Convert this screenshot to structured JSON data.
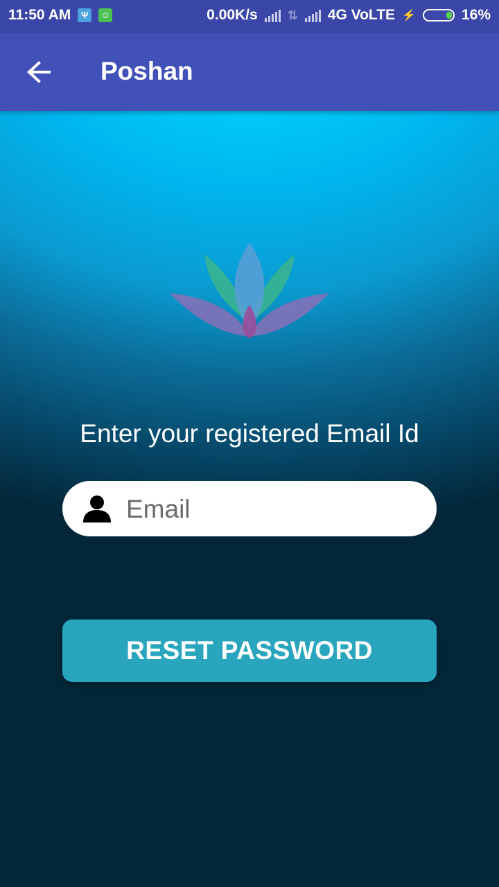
{
  "status_bar": {
    "time": "11:50 AM",
    "net_speed": "0.00K/s",
    "network_type": "4G VoLTE",
    "battery_percent": "16%",
    "icons": [
      "usb-icon",
      "android-bot-icon",
      "signal-icon",
      "data-arrows-icon",
      "signal-icon",
      "charging-icon",
      "battery-icon"
    ]
  },
  "app_bar": {
    "title": "Poshan",
    "back_icon": "arrow-left-icon"
  },
  "logo": {
    "name": "lotus-logo",
    "colors": [
      "#3bb58c",
      "#5a9fd6",
      "#8a6fb8",
      "#9c4e9a"
    ]
  },
  "form": {
    "prompt": "Enter your registered Email Id",
    "email_placeholder": "Email",
    "email_value": "",
    "email_icon": "person-icon",
    "reset_button": "RESET PASSWORD"
  },
  "colors": {
    "status_bar": "#3b47a8",
    "app_bar": "#4151b8",
    "button": "#29a6bd",
    "background_top": "#00e5ff",
    "background_bottom": "#032739"
  }
}
